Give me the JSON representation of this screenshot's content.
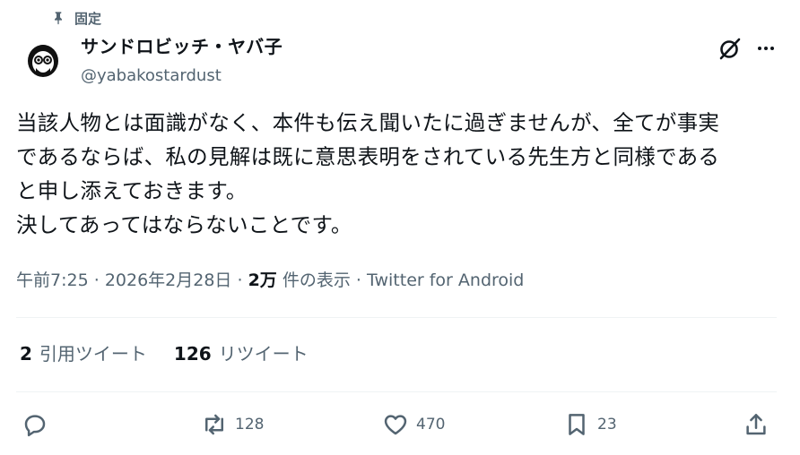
{
  "pinned_label": "固定",
  "author": {
    "name": "サンドロビッチ・ヤバ子",
    "handle": "@yabakostardust"
  },
  "tweet": {
    "text": "当該人物とは面識がなく、本件も伝え聞いたに過ぎませんが、全てが事実\nであるならば、私の見解は既に意思表明をされている先生方と同様である\nと申し添えておきます。\n決してあってはならないことです。",
    "time": "午前7:25",
    "date": "2026年2月28日",
    "sep": "·",
    "views_count": "2万",
    "views_label": "件の表示",
    "client": "Twitter for Android"
  },
  "stats": {
    "quote_count": "2",
    "quote_label": "引用ツイート",
    "retweet_count": "126",
    "retweet_label": "リツイート"
  },
  "actions": {
    "reply": "",
    "retweet": "128",
    "like": "470",
    "bookmark": "23"
  },
  "colors": {
    "text": "#0f1419",
    "secondary": "#536471",
    "divider": "#eff3f4"
  }
}
